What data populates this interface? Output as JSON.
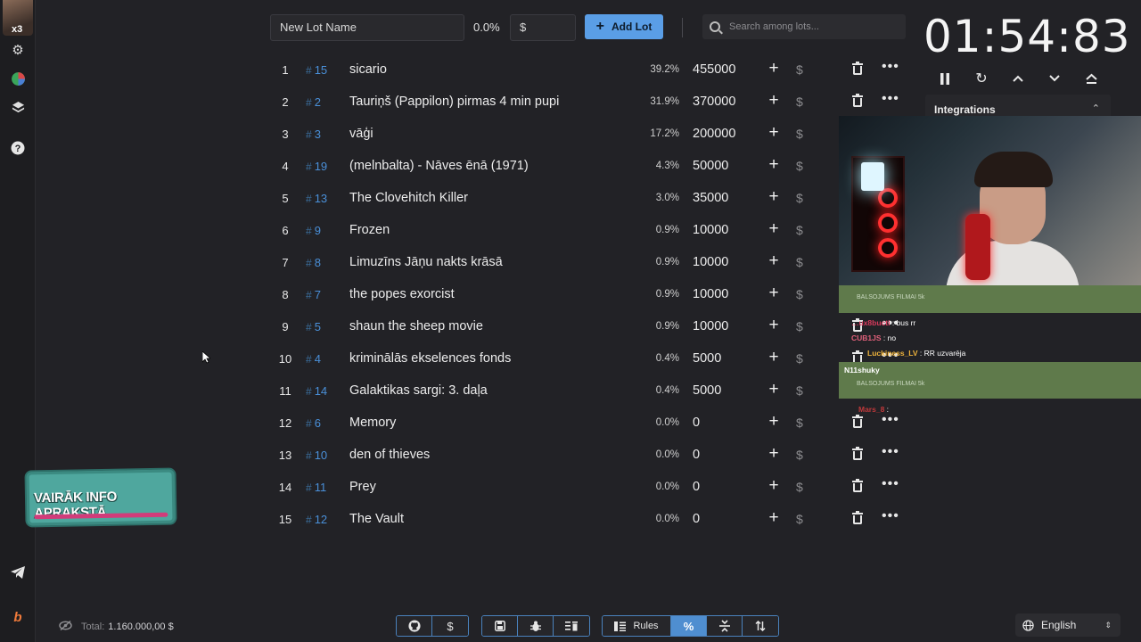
{
  "rail": {
    "avatar_badge": "x3",
    "icons": [
      "gear-icon",
      "pie-chart-icon",
      "layers-icon",
      "help-icon",
      "telegram-icon",
      "boosty-icon"
    ]
  },
  "toolbar": {
    "lot_name_placeholder": "New Lot Name",
    "percent": "0.0%",
    "amount_placeholder": "$",
    "add_lot_label": "Add Lot",
    "search_placeholder": "Search among lots..."
  },
  "lots": [
    {
      "idx": "1",
      "id": "15",
      "name": "sicario",
      "pct": "39.2%",
      "amount": "455000"
    },
    {
      "idx": "2",
      "id": "2",
      "name": "Tauriņš (Pappilon) pirmas 4 min pupi",
      "pct": "31.9%",
      "amount": "370000"
    },
    {
      "idx": "3",
      "id": "3",
      "name": "vāģi",
      "pct": "17.2%",
      "amount": "200000"
    },
    {
      "idx": "4",
      "id": "19",
      "name": "(melnbalta) - Nāves ēnā (1971)",
      "pct": "4.3%",
      "amount": "50000"
    },
    {
      "idx": "5",
      "id": "13",
      "name": "The Clovehitch Killer",
      "pct": "3.0%",
      "amount": "35000"
    },
    {
      "idx": "6",
      "id": "9",
      "name": "Frozen",
      "pct": "0.9%",
      "amount": "10000"
    },
    {
      "idx": "7",
      "id": "8",
      "name": "Limuzīns Jāņu nakts krāsā",
      "pct": "0.9%",
      "amount": "10000"
    },
    {
      "idx": "8",
      "id": "7",
      "name": "the popes exorcist",
      "pct": "0.9%",
      "amount": "10000"
    },
    {
      "idx": "9",
      "id": "5",
      "name": "shaun the sheep movie",
      "pct": "0.9%",
      "amount": "10000"
    },
    {
      "idx": "10",
      "id": "4",
      "name": "kriminālās ekselences fonds",
      "pct": "0.4%",
      "amount": "5000"
    },
    {
      "idx": "11",
      "id": "14",
      "name": "Galaktikas sargi: 3. daļa",
      "pct": "0.4%",
      "amount": "5000"
    },
    {
      "idx": "12",
      "id": "6",
      "name": "Memory",
      "pct": "0.0%",
      "amount": "0"
    },
    {
      "idx": "13",
      "id": "10",
      "name": "den of thieves",
      "pct": "0.0%",
      "amount": "0"
    },
    {
      "idx": "14",
      "id": "11",
      "name": "Prey",
      "pct": "0.0%",
      "amount": "0"
    },
    {
      "idx": "15",
      "id": "12",
      "name": "The Vault",
      "pct": "0.0%",
      "amount": "0"
    }
  ],
  "row_labels": {
    "hash": "#",
    "plus": "+",
    "dollar": "$",
    "more": "•••"
  },
  "timer": {
    "value": "01:54:83"
  },
  "integrations": {
    "label": "Integrations"
  },
  "chat": [
    {
      "user": "BALSOJUMS FILMAI 5k",
      "text": ""
    },
    {
      "user": "…ux8bucti",
      "text": " : bus rr"
    },
    {
      "user": "CUB1JS",
      "text": " : no"
    },
    {
      "user": "Luckiness_LV",
      "text": " : RR uzvarēja"
    },
    {
      "user": "N11shuky",
      "text": ""
    },
    {
      "user": "BALSOJUMS FILMAI 5k",
      "text": ""
    },
    {
      "user": "Mars_8",
      "text": " :"
    }
  ],
  "promo": {
    "text": "VAIRĀK INFO APRAKSTĀ"
  },
  "footer": {
    "total_label": "Total:",
    "total_value": "1.160.000,00 $",
    "rules_label": "Rules",
    "language": "English"
  },
  "colors": {
    "accent": "#5a9ee6",
    "id_link": "#4a90d9",
    "background": "#222226"
  }
}
